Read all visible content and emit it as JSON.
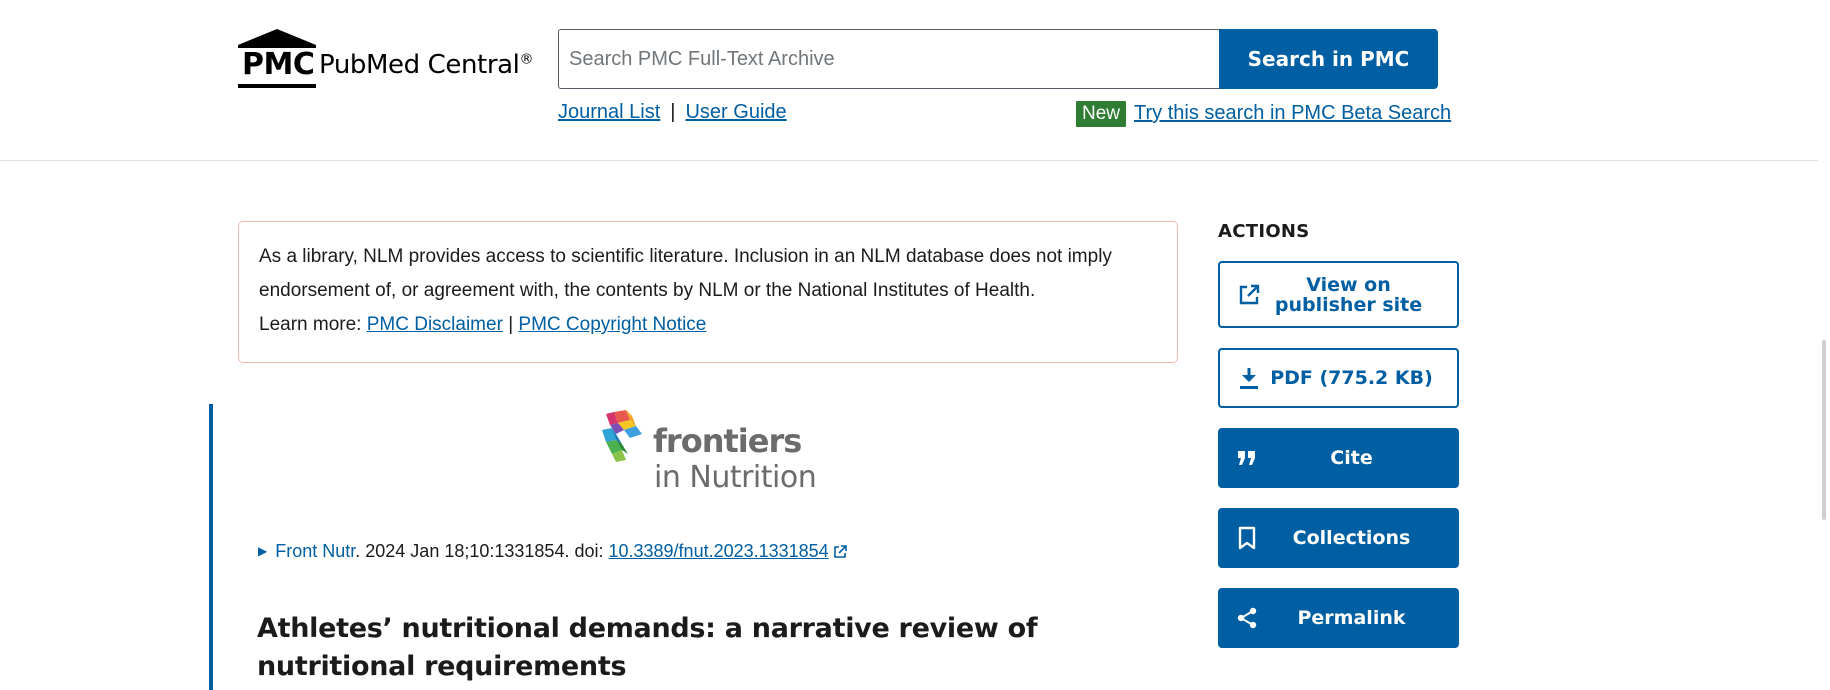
{
  "header": {
    "logo_abbr": "PMC",
    "logo_name": "PubMed Central",
    "logo_reg": "®",
    "search_placeholder": "Search PMC Full-Text Archive",
    "search_button": "Search in PMC",
    "links": [
      {
        "label": "Journal List"
      },
      {
        "label": "User Guide"
      }
    ],
    "link_separator": "|",
    "new_badge": "New",
    "beta_link": "Try this search in PMC Beta Search"
  },
  "disclaimer": {
    "text": "As a library, NLM provides access to scientific literature. Inclusion in an NLM database does not imply endorsement of, or agreement with, the contents by NLM or the National Institutes of Health.",
    "learn_more": "Learn more:",
    "link1": "PMC Disclaimer",
    "separator": "|",
    "link2": "PMC Copyright Notice"
  },
  "article": {
    "journal_logo_name": "frontiers",
    "journal_logo_sub": "in Nutrition",
    "journal": "Front Nutr",
    "citation_rest": ". 2024 Jan 18;10:1331854. doi: ",
    "doi": "10.3389/fnut.2023.1331854",
    "title": "Athletes’ nutritional demands: a narrative review of nutritional requirements"
  },
  "actions": {
    "label": "ACTIONS",
    "items": [
      {
        "label": "View on publisher site",
        "icon": "external-link-icon"
      },
      {
        "label": "PDF (775.2 KB)",
        "icon": "download-icon"
      },
      {
        "label": "Cite",
        "icon": "quote-icon"
      },
      {
        "label": "Collections",
        "icon": "bookmark-icon"
      },
      {
        "label": "Permalink",
        "icon": "share-icon"
      }
    ]
  },
  "colors": {
    "primary": "#005ea2",
    "new_badge": "#2e7d32",
    "disclaimer_border": "#f2b8a9",
    "text": "#1b1b1b"
  }
}
